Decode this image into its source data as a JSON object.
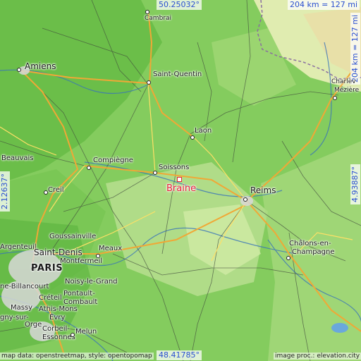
{
  "map": {
    "highlight_city": "Braine",
    "colors": {
      "highlight": "#e8203a",
      "coord_text": "#2a4fd0",
      "lowland": "#6cc04a",
      "upland": "#c8e69a"
    },
    "coords": {
      "north": "50.25032°",
      "south": "48.41785°",
      "west": "2.12637°",
      "east": "4.93887°",
      "scale_horizontal": "204 km = 127 mi",
      "scale_vertical": "204 km = 127 mi"
    },
    "cities": {
      "amiens": "Amiens",
      "cambrai": "Cambrai",
      "saint_quentin": "Saint-Quentin",
      "laon": "Laon",
      "soissons": "Soissons",
      "compiegne": "Compiègne",
      "beauvais": "Beauvais",
      "creil": "Creil",
      "reims": "Reims",
      "charleville": "Charlev",
      "mezieres": "Mézière",
      "chalons_1": "Châlons-en-",
      "chalons_2": "Champagne",
      "paris": "PARIS",
      "saint_denis": "Saint-Denis",
      "goussainville": "Goussainville",
      "argenteuil": "Argenteuil",
      "meaux": "Meaux",
      "montfermeil": "Montfermeil",
      "noisy": "Noisy-le-Grand",
      "pontault_1": "Pontault-",
      "pontault_2": "Combault",
      "creteil": "Créteil",
      "athis": "Athis-Mons",
      "massy": "Massy",
      "boulogne": "ne-Billancourt",
      "evry": "Évry",
      "corbeil_1": "Corbeil-",
      "corbeil_2": "Essonnes",
      "melun": "Melun",
      "gny": "gny-sur-",
      "orge": "Orge"
    },
    "credits": {
      "left": "map data: openstreetmap, style: opentopomap",
      "right": "image proc.: elevation.city"
    }
  }
}
